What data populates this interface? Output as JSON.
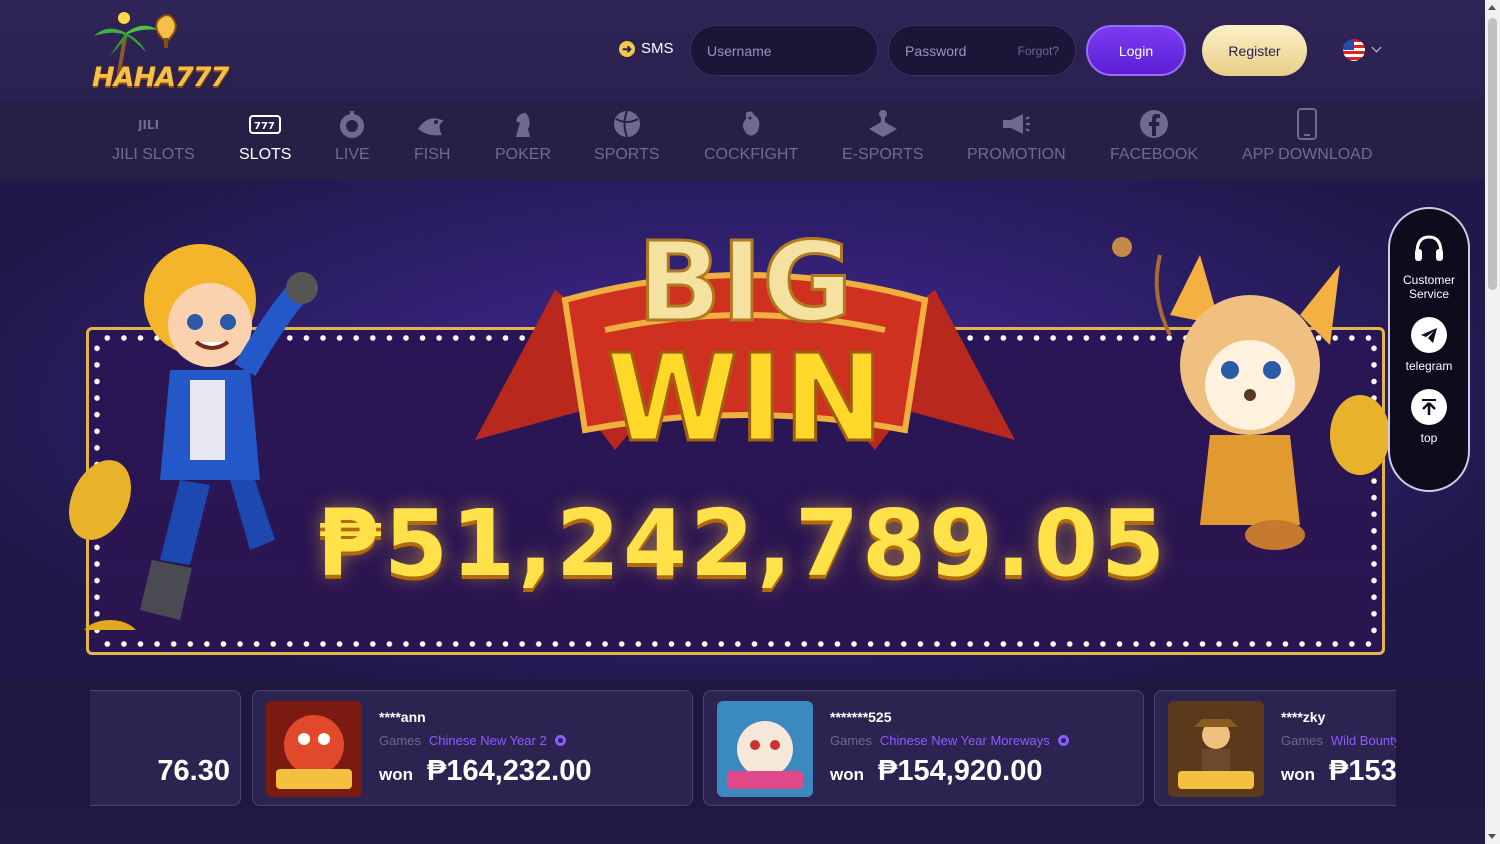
{
  "header": {
    "logo_text": "HAHA777",
    "sms_label": "SMS",
    "username_placeholder": "Username",
    "password_placeholder": "Password",
    "forgot_label": "Forgot?",
    "login_label": "Login",
    "register_label": "Register",
    "language_icon": "us-flag-icon"
  },
  "nav": {
    "items": [
      {
        "label": "JILI SLOTS",
        "icon": "jili-icon",
        "active": false
      },
      {
        "label": "SLOTS",
        "icon": "slot-777-icon",
        "active": true
      },
      {
        "label": "LIVE",
        "icon": "roulette-icon",
        "active": false
      },
      {
        "label": "FISH",
        "icon": "fish-icon",
        "active": false
      },
      {
        "label": "POKER",
        "icon": "chess-knight-icon",
        "active": false
      },
      {
        "label": "SPORTS",
        "icon": "ball-icon",
        "active": false
      },
      {
        "label": "COCKFIGHT",
        "icon": "rooster-icon",
        "active": false
      },
      {
        "label": "E-SPORTS",
        "icon": "joystick-icon",
        "active": false
      },
      {
        "label": "PROMOTION",
        "icon": "megaphone-icon",
        "active": false
      },
      {
        "label": "FACEBOOK",
        "icon": "facebook-icon",
        "active": false
      },
      {
        "label": "APP DOWNLOAD",
        "icon": "phone-icon",
        "active": false
      }
    ]
  },
  "hero": {
    "banner_line1": "BIG",
    "banner_line2": "WIN",
    "amount": "₱51,242,789.05"
  },
  "side_panel": {
    "customer_service": "Customer Service",
    "telegram": "telegram",
    "top": "top"
  },
  "winners": {
    "partial_amount": "76.30",
    "cards": [
      {
        "user": "****ann",
        "games_label": "Games",
        "game": "Chinese New Year 2",
        "won_label": "won",
        "amount": "₱164,232.00"
      },
      {
        "user": "*******525",
        "games_label": "Games",
        "game": "Chinese New Year Moreways",
        "won_label": "won",
        "amount": "₱154,920.00"
      },
      {
        "user": "****zky",
        "games_label": "Games",
        "game": "Wild Bounty Showdown",
        "won_label": "won",
        "amount": "₱153"
      }
    ]
  },
  "colors": {
    "accent_purple": "#7b3cf0",
    "gold": "#ffe14a",
    "background": "#1f1740"
  }
}
